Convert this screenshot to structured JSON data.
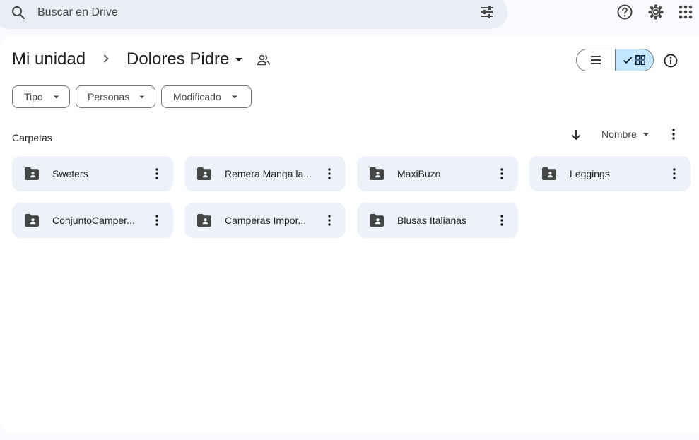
{
  "search": {
    "placeholder": "Buscar en Drive"
  },
  "breadcrumb": {
    "root": "Mi unidad",
    "current": "Dolores Pidre"
  },
  "filters": [
    {
      "label": "Tipo"
    },
    {
      "label": "Personas"
    },
    {
      "label": "Modificado"
    }
  ],
  "section": {
    "title": "Carpetas"
  },
  "sort": {
    "label": "Nombre"
  },
  "view": {
    "active": "grid"
  },
  "folders": [
    {
      "name": "Sweters"
    },
    {
      "name": "Remera Manga la..."
    },
    {
      "name": "MaxiBuzo"
    },
    {
      "name": "Leggings"
    },
    {
      "name": "ConjuntoCamper..."
    },
    {
      "name": "Camperas Impor..."
    },
    {
      "name": "Blusas Italianas"
    }
  ],
  "icons": {
    "search": "search-icon",
    "tune": "tune-icon",
    "help": "help-icon",
    "settings": "gear-icon",
    "apps": "apps-grid-icon",
    "info": "info-icon",
    "folder": "shared-folder-icon",
    "more": "more-vert-icon"
  },
  "colors": {
    "accent": "#c2e7ff",
    "chip_bg": "#edf2fa",
    "search_bg": "#e9eef6"
  }
}
